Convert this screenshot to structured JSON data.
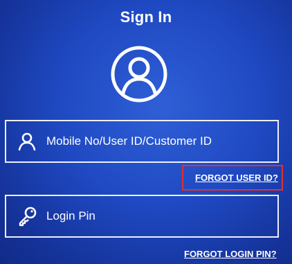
{
  "screen": {
    "title": "Sign In",
    "avatar_icon": "user-circle-icon"
  },
  "user_field": {
    "icon": "user-icon",
    "placeholder": "Mobile No/User ID/Customer ID"
  },
  "forgot_user_link": {
    "label": "FORGOT USER ID?",
    "highlight_color": "#e23030"
  },
  "pin_field": {
    "icon": "key-icon",
    "placeholder": "Login Pin"
  },
  "forgot_pin_link": {
    "label": "FORGOT LOGIN PIN?"
  },
  "colors": {
    "background": "#1f49c2",
    "foreground": "#ffffff"
  }
}
